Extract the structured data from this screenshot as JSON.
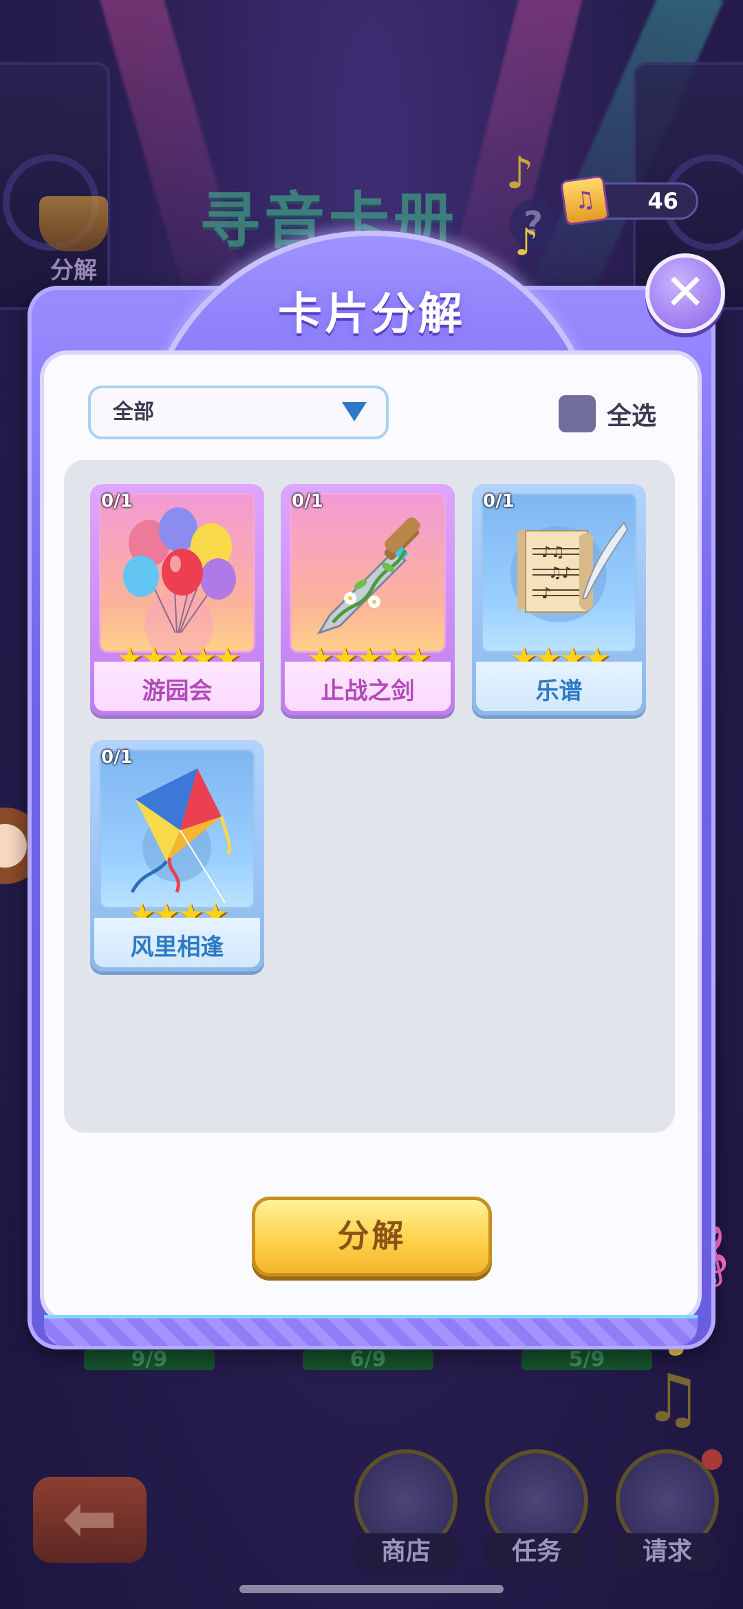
{
  "background": {
    "scene_title": "寻音卡册",
    "side_decompose_label": "分解",
    "coin_count": "46",
    "help_symbol": "?",
    "progress": [
      "9/9",
      "6/9",
      "5/9"
    ],
    "nav": [
      {
        "label": "商店",
        "icon": "mailbox-icon"
      },
      {
        "label": "任务",
        "icon": "book-icon"
      },
      {
        "label": "请求",
        "icon": "request-icon"
      }
    ],
    "back_icon": "arrow-left-icon"
  },
  "dialog": {
    "title": "卡片分解",
    "close_icon": "close-icon",
    "filter": {
      "selected": "全部",
      "icon": "chevron-down-icon"
    },
    "select_all_label": "全选",
    "action_label": "分解"
  },
  "cards": [
    {
      "count": "0/1",
      "stars": "★★★★★",
      "name": "游园会",
      "rarity": "pink",
      "icon": "balloons-icon"
    },
    {
      "count": "0/1",
      "stars": "★★★★★",
      "name": "止战之剑",
      "rarity": "pink",
      "icon": "sword-icon"
    },
    {
      "count": "0/1",
      "stars": "★★★★",
      "name": "乐谱",
      "rarity": "blue",
      "icon": "music-score-icon"
    },
    {
      "count": "0/1",
      "stars": "★★★★",
      "name": "风里相逢",
      "rarity": "blue",
      "icon": "kite-icon"
    }
  ],
  "colors": {
    "dialog_purple": "#6e62e8",
    "button_gold": "#ffd24c",
    "pink_card": "#c07cef",
    "blue_card": "#8cb8ec"
  }
}
